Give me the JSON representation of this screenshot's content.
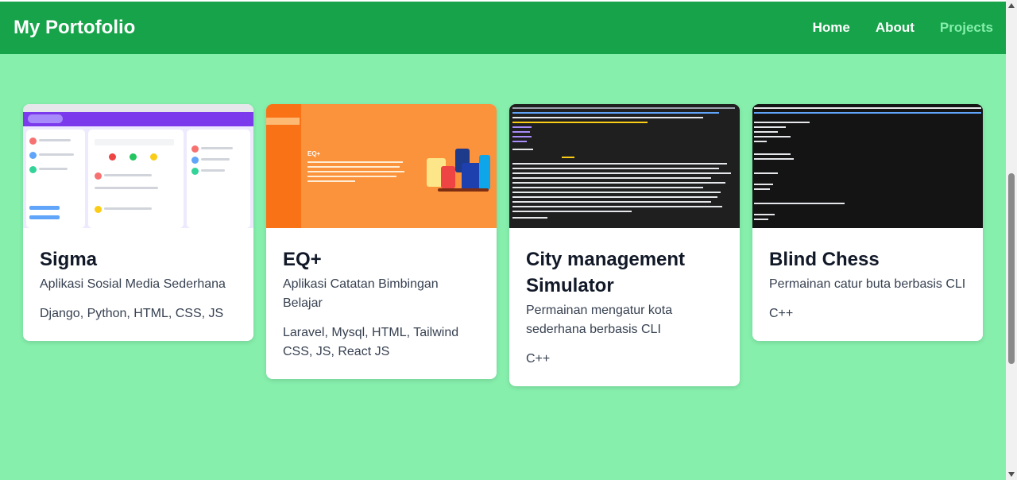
{
  "navbar": {
    "brand": "My Portofolio",
    "links": [
      {
        "label": "Home",
        "active": false
      },
      {
        "label": "About",
        "active": false
      },
      {
        "label": "Projects",
        "active": true
      }
    ]
  },
  "projects": [
    {
      "title": "Sigma",
      "description": "Aplikasi Sosial Media Sederhana",
      "tech": "Django, Python, HTML, CSS, JS",
      "image_icon": "sigma-screenshot-thumbnail"
    },
    {
      "title": "EQ+",
      "description": "Aplikasi Catatan Bimbingan Belajar",
      "tech": "Laravel, Mysql, HTML, Tailwind CSS, JS, React JS",
      "image_icon": "eq-plus-screenshot-thumbnail"
    },
    {
      "title": "City management Simulator",
      "description": "Permainan mengatur kota sederhana berbasis CLI",
      "tech": "C++",
      "image_icon": "city-terminal-screenshot-thumbnail"
    },
    {
      "title": "Blind Chess",
      "description": "Permainan catur buta berbasis CLI",
      "tech": "C++",
      "image_icon": "chess-terminal-screenshot-thumbnail"
    }
  ],
  "thumbnails": {
    "eq_heading": "EQ+"
  },
  "colors": {
    "navbar": "#16a34a",
    "page_background": "#86efac",
    "active_link": "#86efac",
    "card_background": "#ffffff"
  }
}
